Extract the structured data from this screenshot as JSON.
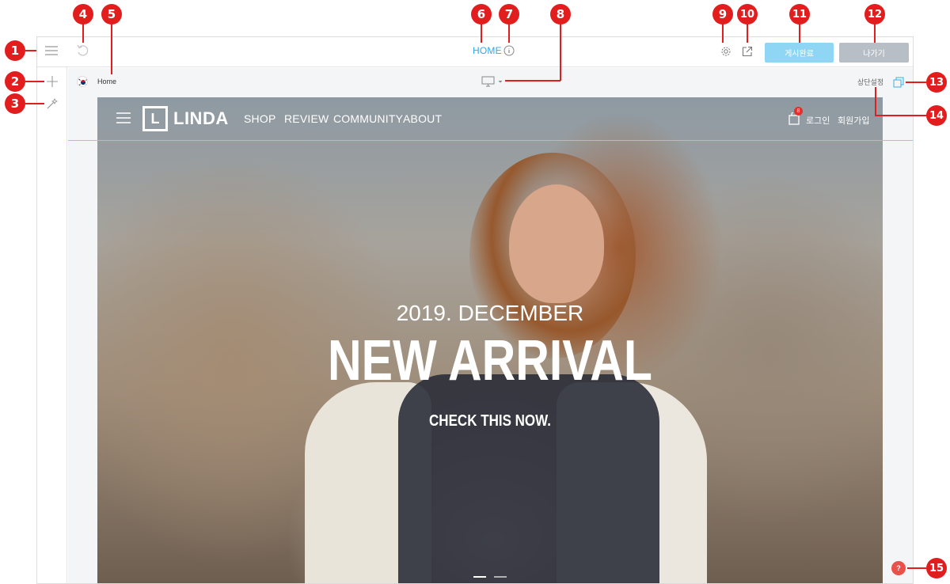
{
  "topbar": {
    "page_title": "HOME",
    "publish_label": "게시완료",
    "exit_label": "나가기"
  },
  "subbar": {
    "page_name": "Home",
    "header_setting_label": "상단설정"
  },
  "site": {
    "logo_letter": "L",
    "logo_text": "LINDA",
    "nav": [
      "SHOP",
      "REVIEW",
      "COMMUNITY",
      "ABOUT"
    ],
    "cart_count": "8",
    "login_label": "로그인",
    "join_label": "회원가입",
    "hero": {
      "date": "2019. DECEMBER",
      "title": "NEW ARRIVAL",
      "cta": "CHECK THIS NOW."
    }
  },
  "help_label": "?",
  "callouts": [
    "1",
    "2",
    "3",
    "4",
    "5",
    "6",
    "7",
    "8",
    "9",
    "10",
    "11",
    "12",
    "13",
    "14",
    "15"
  ],
  "colors": {
    "accent": "#2fa8e8",
    "publish_bg": "#8fd6f5",
    "exit_bg": "#b7bec6",
    "callout": "#e21d1d"
  }
}
